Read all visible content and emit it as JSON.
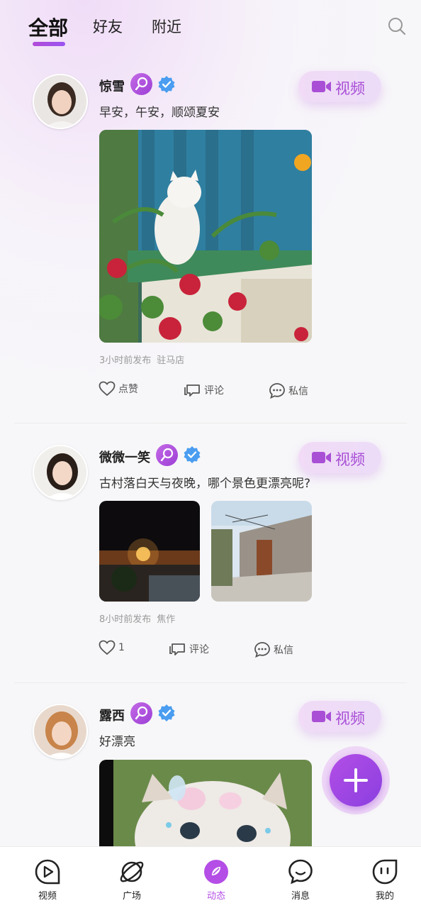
{
  "header": {
    "tabs": [
      {
        "label": "全部",
        "active": true
      },
      {
        "label": "好友",
        "active": false
      },
      {
        "label": "附近",
        "active": false
      }
    ],
    "search_icon": "search-icon"
  },
  "posts": [
    {
      "username": "惊雪",
      "caption": "早安，午安，顺颂夏安",
      "time": "3小时前发布",
      "location": "驻马店",
      "video_label": "视频",
      "like_label": "点赞",
      "comment_label": "评论",
      "message_label": "私信",
      "images": [
        "white-cat-with-roses"
      ]
    },
    {
      "username": "微微一笑",
      "caption": "古村落白天与夜晚，哪个景色更漂亮呢?",
      "time": "8小时前发布",
      "location": "焦作",
      "video_label": "视频",
      "like_label": "1",
      "comment_label": "评论",
      "message_label": "私信",
      "images": [
        "village-night",
        "village-day-alley"
      ]
    },
    {
      "username": "露西",
      "caption": "好漂亮",
      "video_label": "视频",
      "images": [
        "cat-with-hair-clips"
      ]
    }
  ],
  "fab": {
    "icon": "plus-icon"
  },
  "bottom_nav": [
    {
      "label": "视频",
      "icon": "video-play-icon",
      "active": false
    },
    {
      "label": "广场",
      "icon": "planet-icon",
      "active": false
    },
    {
      "label": "动态",
      "icon": "moments-icon",
      "active": true
    },
    {
      "label": "消息",
      "icon": "chat-bubble-icon",
      "active": false
    },
    {
      "label": "我的",
      "icon": "profile-face-icon",
      "active": false
    }
  ],
  "colors": {
    "accent": "#b44ee6",
    "video_text": "#a94fd6",
    "verified": "#4a9df0",
    "background": "#f7f7f9"
  }
}
